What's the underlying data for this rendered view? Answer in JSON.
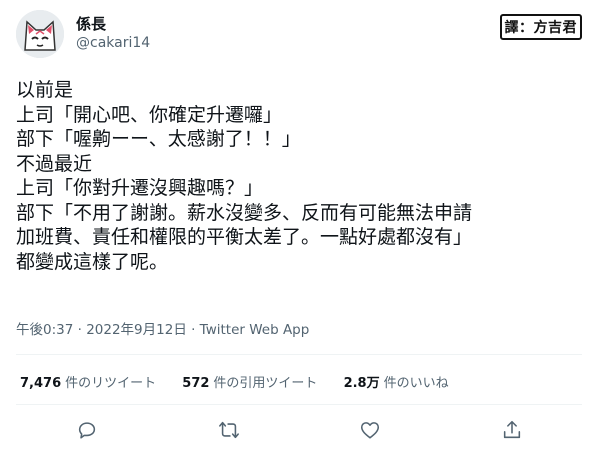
{
  "author": {
    "display_name": "係長",
    "handle": "@cakari14",
    "avatar_icon": "cat-mask-avatar"
  },
  "translator_credit": "譯：方吉君",
  "tweet": {
    "lines": [
      "以前是",
      "上司「開心吧、你確定升遷囉」",
      "部下「喔齁ーー、太感謝了！！」",
      "不過最近",
      "上司「你對升遷沒興趣嗎？」",
      "部下「不用了謝謝。薪水沒變多、反而有可能無法申請",
      "加班費、責任和權限的平衡太差了。一點好處都沒有」",
      "都變成這樣了呢。"
    ]
  },
  "meta": {
    "timestamp": "午後0:37 · 2022年9月12日 · Twitter Web App"
  },
  "stats": [
    {
      "value": "7,476",
      "label": "件のリツイート"
    },
    {
      "value": "572",
      "label": "件の引用ツイート"
    },
    {
      "value": "2.8万",
      "label": "件のいいね"
    }
  ],
  "actions": [
    {
      "name": "reply",
      "icon": "reply-icon"
    },
    {
      "name": "retweet",
      "icon": "retweet-icon"
    },
    {
      "name": "like",
      "icon": "heart-icon"
    },
    {
      "name": "share",
      "icon": "share-icon"
    }
  ],
  "colors": {
    "text": "#0f1419",
    "secondary": "#536471",
    "divider": "#eff3f4"
  }
}
